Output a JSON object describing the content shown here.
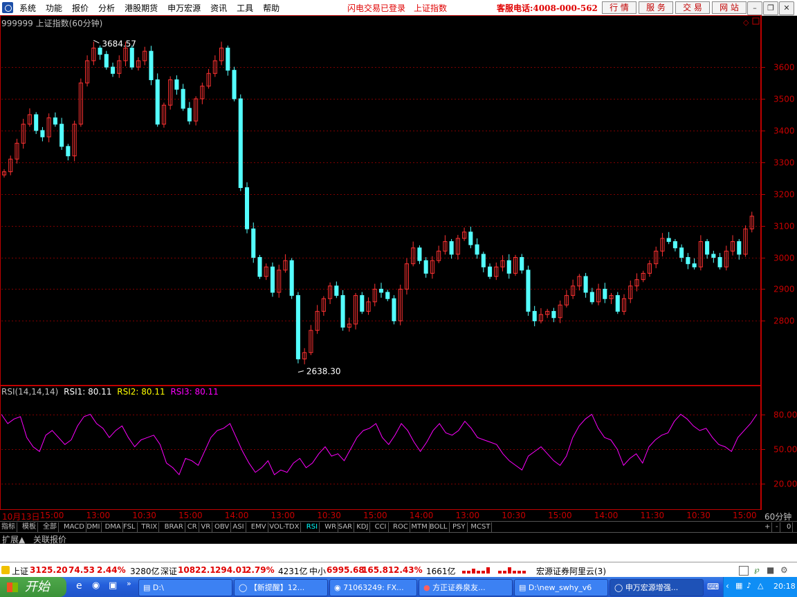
{
  "menubar": {
    "items": [
      "系统",
      "功能",
      "报价",
      "分析",
      "港股期货",
      "申万宏源",
      "资讯",
      "工具",
      "帮助"
    ],
    "flash_status": "闪电交易已登录",
    "index_name": "上证指数",
    "hotline": "客服电话:4008-000-562",
    "buttons": [
      "行 情",
      "服 务",
      "交 易",
      "网 站"
    ],
    "window_controls": [
      "minimize-icon",
      "restore-icon",
      "close-icon"
    ]
  },
  "chart": {
    "title": "999999 上证指数(60分钟)",
    "high_label": "3684.57",
    "low_label": "2638.30",
    "price_axis": [
      "3600",
      "3500",
      "3400",
      "3300",
      "3200",
      "3100",
      "3000",
      "2900",
      "2800"
    ],
    "up_color": "#ff3232",
    "down_color": "#54ffff",
    "grid_color": "#800000"
  },
  "chart_data": {
    "type": "candlestick",
    "title": "999999 上证指数(60分钟)",
    "ylim": [
      2620,
      3720
    ],
    "high": 3684.57,
    "low": 2638.3,
    "closes": [
      3270,
      3310,
      3360,
      3420,
      3450,
      3400,
      3380,
      3440,
      3420,
      3350,
      3320,
      3420,
      3550,
      3620,
      3660,
      3640,
      3600,
      3580,
      3620,
      3660,
      3600,
      3620,
      3650,
      3560,
      3420,
      3480,
      3560,
      3530,
      3470,
      3430,
      3500,
      3540,
      3580,
      3620,
      3660,
      3590,
      3500,
      3220,
      3090,
      3000,
      2940,
      2970,
      2890,
      2960,
      2990,
      2880,
      2680,
      2700,
      2770,
      2830,
      2870,
      2910,
      2880,
      2780,
      2790,
      2880,
      2830,
      2860,
      2900,
      2890,
      2870,
      2800,
      2900,
      2980,
      3030,
      2990,
      2950,
      2990,
      3020,
      3050,
      3010,
      3060,
      3080,
      3040,
      3010,
      2970,
      2940,
      2970,
      2990,
      2950,
      3000,
      2960,
      2830,
      2800,
      2820,
      2830,
      2810,
      2850,
      2880,
      2910,
      2940,
      2890,
      2860,
      2900,
      2870,
      2880,
      2830,
      2870,
      2910,
      2930,
      2950,
      2980,
      3020,
      3060,
      3050,
      3030,
      3000,
      2980,
      2970,
      3050,
      3010,
      3000,
      2970,
      3020,
      3050,
      3010,
      3090,
      3130
    ],
    "rsi": {
      "header": "RSI(14,14,14)",
      "labels": [
        "RSI1: 80.11",
        "RSI2: 80.11",
        "RSI3: 80.11"
      ],
      "axis": [
        "80.00",
        "50.00",
        "20.00"
      ],
      "values": [
        80,
        72,
        76,
        78,
        60,
        52,
        48,
        62,
        66,
        60,
        54,
        58,
        70,
        78,
        80,
        72,
        68,
        60,
        66,
        70,
        60,
        52,
        58,
        60,
        62,
        54,
        38,
        34,
        28,
        42,
        40,
        36,
        48,
        60,
        66,
        68,
        72,
        60,
        48,
        38,
        30,
        34,
        40,
        28,
        32,
        30,
        38,
        42,
        34,
        38,
        46,
        52,
        44,
        46,
        40,
        50,
        60,
        66,
        68,
        72,
        60,
        54,
        62,
        72,
        66,
        56,
        48,
        56,
        66,
        72,
        64,
        62,
        66,
        74,
        68,
        60,
        58,
        56,
        54,
        46,
        40,
        36,
        32,
        44,
        48,
        52,
        46,
        40,
        36,
        44,
        60,
        70,
        76,
        80,
        68,
        60,
        58,
        50,
        36,
        42,
        46,
        38,
        52,
        58,
        62,
        64,
        74,
        80,
        76,
        70,
        66,
        68,
        60,
        54,
        52,
        48,
        60,
        66,
        72,
        80
      ],
      "color": "#ff00ff",
      "ylim": [
        0,
        100
      ]
    },
    "x_ticks": [
      "10月13日",
      "15:00",
      "13:00",
      "10:30",
      "15:00",
      "14:00",
      "13:00",
      "10:30",
      "15:00",
      "14:00",
      "13:00",
      "10:30",
      "15:00",
      "14:00",
      "11:30",
      "10:30",
      "15:00"
    ],
    "period": "60分钟"
  },
  "tabs": [
    "指标",
    "模板",
    "全部",
    "MACD",
    "DMI",
    "DMA",
    "FSL",
    "TRIX",
    "BRAR",
    "CR",
    "VR",
    "OBV",
    "ASI",
    "EMV",
    "VOL-TDX",
    "RSI",
    "WR",
    "SAR",
    "KDJ",
    "CCI",
    "ROC",
    "MTM",
    "BOLL",
    "PSY",
    "MCST"
  ],
  "active_tab": "RSI",
  "tab_right": [
    "+",
    "-",
    "0"
  ],
  "tabs2": [
    "扩展▲",
    "关联报价"
  ],
  "ticker": {
    "sh_label": "上证",
    "sh_price": "3125.20",
    "sh_change": "74.53",
    "sh_pct": "2.44%",
    "sh_amount": "3280亿",
    "sz_label": "深证",
    "sz_price": "10822.1",
    "sz_change": "294.01",
    "sz_pct": "2.79%",
    "sz_amount": "4231亿",
    "zx_label": "中小",
    "zx_price": "6995.68",
    "zx_change": "165.81",
    "zx_pct": "2.43%",
    "zx_amount": "1661亿",
    "server": "宏源证券阿里云(3)"
  },
  "taskbar": {
    "start": "开始",
    "tasks": [
      "D:\\",
      "【新提醒】12...",
      "71063249: FX...",
      "方正证券泉友...",
      "D:\\new_swhy_v6",
      "申万宏源增强..."
    ],
    "clock": "20:18"
  }
}
